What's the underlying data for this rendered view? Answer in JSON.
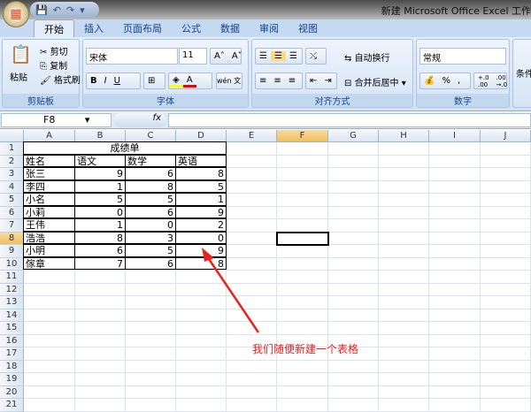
{
  "window": {
    "title": "新建 Microsoft Office Excel 工作"
  },
  "qat": {
    "save": "💾",
    "undo": "↶",
    "redo": "↷",
    "more": "▾"
  },
  "tabs": [
    "开始",
    "插入",
    "页面布局",
    "公式",
    "数据",
    "审阅",
    "视图"
  ],
  "ribbon": {
    "clipboard": {
      "label": "剪贴板",
      "paste": "粘贴",
      "cut": "剪切",
      "copy": "复制",
      "format_painter": "格式刷"
    },
    "font": {
      "label": "字体",
      "font_name": "宋体",
      "font_size": "11",
      "bold": "B",
      "italic": "I",
      "underline": "U",
      "grow": "A˄",
      "shrink": "A˅",
      "phonetic": "wén 文"
    },
    "alignment": {
      "label": "对齐方式",
      "wrap": "自动换行",
      "merge": "合并后居中"
    },
    "number": {
      "label": "数字",
      "format": "常规",
      "percent": "%",
      "comma": ",",
      "inc_decimal": "+.0 .00",
      "dec_decimal": ".00 →.0"
    },
    "styles": {
      "conditional": "条件"
    }
  },
  "formula_bar": {
    "name_box": "F8",
    "fx": "fx",
    "value": ""
  },
  "columns": [
    "A",
    "B",
    "C",
    "D",
    "E",
    "F",
    "G",
    "H",
    "I",
    "J"
  ],
  "selected_cell": "F8",
  "sheet": {
    "title": "成绩单",
    "headers": [
      "姓名",
      "语文",
      "数学",
      "英语"
    ],
    "rows": [
      [
        "张三",
        "9",
        "6",
        "8"
      ],
      [
        "李四",
        "1",
        "8",
        "5"
      ],
      [
        "小名",
        "5",
        "5",
        "1"
      ],
      [
        "小莉",
        "0",
        "6",
        "9"
      ],
      [
        "王伟",
        "1",
        "0",
        "2"
      ],
      [
        "浩浩",
        "8",
        "3",
        "0"
      ],
      [
        "小明",
        "6",
        "5",
        "9"
      ],
      [
        "傢章",
        "7",
        "6",
        "8"
      ]
    ]
  },
  "annotation": {
    "text": "我们随便新建一个表格",
    "color": "#e8231f"
  }
}
